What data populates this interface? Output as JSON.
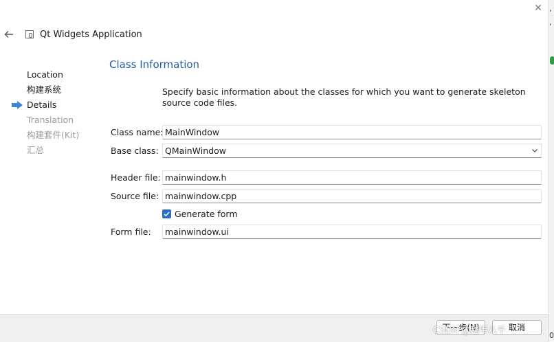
{
  "header": {
    "app_title": "Qt Widgets Application"
  },
  "steps": [
    {
      "label": "Location",
      "state": "done"
    },
    {
      "label": "构建系统",
      "state": "done"
    },
    {
      "label": "Details",
      "state": "current"
    },
    {
      "label": "Translation",
      "state": "pending"
    },
    {
      "label": "构建套件(Kit)",
      "state": "pending"
    },
    {
      "label": "汇总",
      "state": "pending"
    }
  ],
  "main": {
    "title": "Class Information",
    "description": "Specify basic information about the classes for which you want to generate skeleton source code files.",
    "class_name": {
      "label": "Class name:",
      "value": "MainWindow"
    },
    "base_class": {
      "label": "Base class:",
      "value": "QMainWindow"
    },
    "header_file": {
      "label": "Header file:",
      "value": "mainwindow.h"
    },
    "source_file": {
      "label": "Source file:",
      "value": "mainwindow.cpp"
    },
    "generate_form": {
      "label": "Generate form",
      "checked": true
    },
    "form_file": {
      "label": "Form file:",
      "value": "mainwindow.ui"
    }
  },
  "footer": {
    "next_label": "下一步(N)",
    "cancel_label": "取消"
  },
  "watermark": "CSDN @越甲八千",
  "right_strip": {
    "chars": [
      ",",
      ",",
      "0"
    ]
  },
  "colors": {
    "accent": "#1f5e9f",
    "checkbox": "#2b6fc2",
    "step_arrow": "#3c84d6",
    "disabled_text": "#9a9a9a"
  },
  "icons": [
    "close-icon",
    "back-icon",
    "app-icon",
    "step-arrow-icon",
    "chevron-down-icon",
    "checkmark-icon"
  ]
}
